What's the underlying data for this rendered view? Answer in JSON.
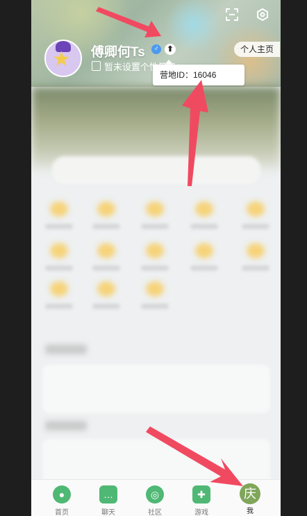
{
  "profile": {
    "username": "傅卿何Ts",
    "gender_icon": "male-icon",
    "badge_icon": "badge-icon",
    "bio": "暂未设置个性签名",
    "homepage_label": "个人主页",
    "tooltip_text": "营地ID：16046"
  },
  "top_bar": {
    "scan_icon": "scan-icon",
    "settings_icon": "settings-icon"
  },
  "bottom_nav": {
    "items": [
      {
        "label": "首页",
        "icon": "home-icon",
        "color": "#4fb874"
      },
      {
        "label": "聊天",
        "icon": "chat-icon",
        "color": "#4fb874"
      },
      {
        "label": "社区",
        "icon": "community-icon",
        "color": "#4fb874"
      },
      {
        "label": "游戏",
        "icon": "game-icon",
        "color": "#4fb874"
      },
      {
        "label": "我",
        "icon": "me-icon",
        "color": "#7fa65a",
        "glyph": "庆",
        "active": true
      }
    ]
  },
  "colors": {
    "accent": "#4fb874",
    "annotation_arrow": "#f04a61"
  }
}
